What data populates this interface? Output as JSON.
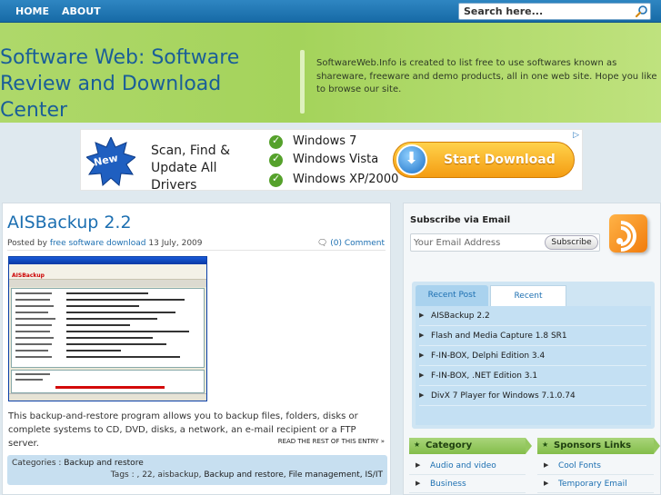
{
  "nav": {
    "items": [
      "HOME",
      "ABOUT"
    ]
  },
  "search": {
    "placeholder": "Search here..."
  },
  "header": {
    "title": "Software Web: Software Review and Download Center",
    "description": "SoftwareWeb.Info is created to list free to use softwares known as shareware, freeware and demo products, all in one web site. Hope you like to browse our site."
  },
  "ad": {
    "badge": "New",
    "headline": "Scan, Find & Update All Drivers",
    "os": [
      "Windows 7",
      "Windows Vista",
      "Windows XP/2000"
    ],
    "cta": "Start Download"
  },
  "post": {
    "title": "AISBackup 2.2",
    "posted_by_prefix": "Posted by",
    "author": "free software download",
    "date": "13 July, 2009",
    "comments": "(0) Comment",
    "screenshot_logo": "AISBackup",
    "body": "This backup-and-restore program allows you to backup files, folders, disks or complete systems to CD, DVD, disks, a network, an e-mail recipient or a FTP server.",
    "read_more": "READ THE REST OF THIS ENTRY »",
    "categories_label": "Categories :",
    "category": "Backup and restore",
    "tags_label": "Tags : , 22, aisbackup,",
    "tags": "Backup and restore, File management, IS/IT"
  },
  "sidebar": {
    "subscribe_title": "Subscribe via Email",
    "email_placeholder": "Your Email Address",
    "subscribe_button": "Subscribe",
    "tabs": [
      "Recent Post",
      "Recent Comments"
    ],
    "recent_posts": [
      "AISBackup 2.2",
      "Flash and Media Capture 1.8 SR1",
      "F-IN-BOX, Delphi Edition 3.4",
      "F-IN-BOX, .NET Edition 3.1",
      "DivX 7 Player for Windows 7.1.0.74"
    ],
    "category_title": "Category",
    "categories": [
      "Audio and video",
      "Business"
    ],
    "sponsors_title": "Sponsors Links",
    "sponsors": [
      "Cool Fonts",
      "Temporary Email"
    ]
  },
  "colors": {
    "nav": "#1f74b1",
    "header": "#a4d35b",
    "link": "#1c6fb1",
    "widget_head": "#95c85f"
  }
}
